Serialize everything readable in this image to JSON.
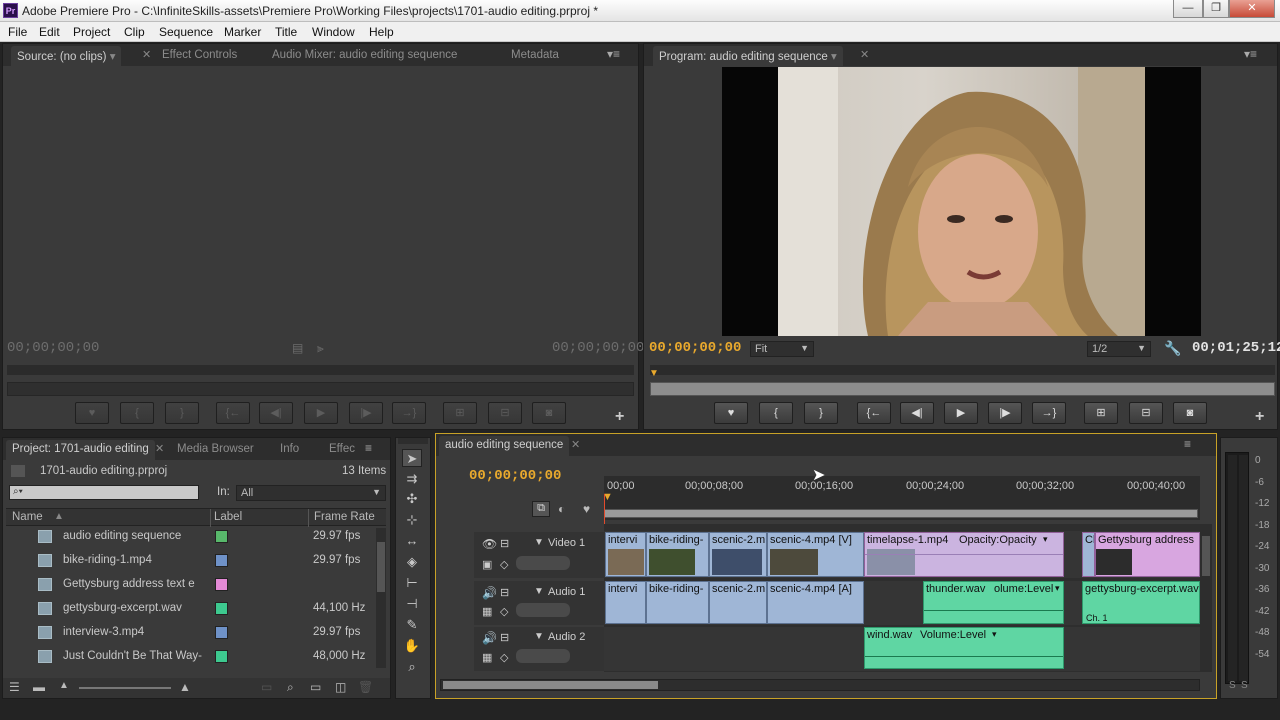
{
  "window": {
    "title": "Adobe Premiere Pro - C:\\InfiniteSkills-assets\\Premiere Pro\\Working Files\\projects\\1701-audio editing.prproj *",
    "app_icon": "Pr",
    "minimize": "—",
    "maximize": "❐",
    "close": "✕"
  },
  "menu": [
    "File",
    "Edit",
    "Project",
    "Clip",
    "Sequence",
    "Marker",
    "Title",
    "Window",
    "Help"
  ],
  "source_monitor": {
    "tabs": [
      "Source: (no clips)",
      "Effect Controls",
      "Audio Mixer: audio editing sequence",
      "Metadata"
    ],
    "timecode_left": "00;00;00;00",
    "timecode_right": "00;00;00;00"
  },
  "program_monitor": {
    "tab": "Program: audio editing sequence",
    "timecode": "00;00;00;00",
    "zoom": "Fit",
    "resolution": "1/2",
    "duration": "00;01;25;12"
  },
  "project_panel": {
    "tabs": [
      "Project: 1701-audio editing",
      "Media Browser",
      "Info",
      "Effec"
    ],
    "project_file": "1701-audio editing.prproj",
    "item_count": "13 Items",
    "search_placeholder": "",
    "in_label": "In:",
    "in_value": "All",
    "columns": [
      "Name",
      "Label",
      "Frame Rate"
    ],
    "items": [
      {
        "name": "audio editing sequence",
        "label_color": "#58b86b",
        "rate": "29.97 fps",
        "icon": "sequence-icon"
      },
      {
        "name": "bike-riding-1.mp4",
        "label_color": "#6f92c8",
        "rate": "29.97 fps",
        "icon": "video-clip-icon"
      },
      {
        "name": "Gettysburg address text e",
        "label_color": "#e48ad6",
        "rate": "",
        "icon": "still-image-icon"
      },
      {
        "name": "gettysburg-excerpt.wav",
        "label_color": "#3dc98f",
        "rate": "44,100 Hz",
        "icon": "audio-clip-icon"
      },
      {
        "name": "interview-3.mp4",
        "label_color": "#6f92c8",
        "rate": "29.97 fps",
        "icon": "video-clip-icon"
      },
      {
        "name": "Just Couldn't Be That Way-",
        "label_color": "#3dc98f",
        "rate": "48,000 Hz",
        "icon": "audio-clip-icon"
      }
    ]
  },
  "timeline": {
    "tab": "audio editing sequence",
    "timecode": "00;00;00;00",
    "ruler": [
      "00;00",
      "00;00;08;00",
      "00;00;16;00",
      "00;00;24;00",
      "00;00;32;00",
      "00;00;40;00"
    ],
    "tracks": {
      "video1": "Video 1",
      "audio1": "Audio 1",
      "audio2": "Audio 2"
    },
    "video_clips": [
      "intervi",
      "bike-riding-",
      "scenic-2.m",
      "scenic-4.mp4 [V]",
      "timelapse-1.mp4",
      "Opacity:Opacity",
      "Cl",
      "Gettysburg address"
    ],
    "audio1_clips": [
      "intervi",
      "bike-riding-",
      "scenic-2.m",
      "scenic-4.mp4 [A]",
      "thunder.wav",
      "olume:Level",
      "gettysburg-excerpt.wav",
      "Ch. 1"
    ],
    "audio2_clips": [
      "wind.wav",
      "Volume:Level"
    ]
  },
  "meter": {
    "labels": [
      "0",
      "-6",
      "-12",
      "-18",
      "-24",
      "-30",
      "-36",
      "-42",
      "-48",
      "-54"
    ],
    "solo": "S",
    "solo2": "S"
  }
}
